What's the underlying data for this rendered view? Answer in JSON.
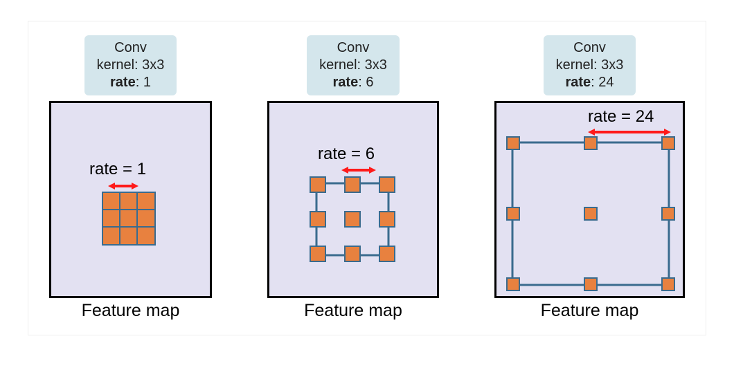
{
  "panels": [
    {
      "conv_title": "Conv",
      "kernel_line": "kernel: 3x3",
      "rate_label_prefix": "rate",
      "rate_value": "1",
      "rate_eq": "rate = 1",
      "fmap_caption": "Feature map"
    },
    {
      "conv_title": "Conv",
      "kernel_line": "kernel: 3x3",
      "rate_label_prefix": "rate",
      "rate_value": "6",
      "rate_eq": "rate = 6",
      "fmap_caption": "Feature map"
    },
    {
      "conv_title": "Conv",
      "kernel_line": "kernel: 3x3",
      "rate_label_prefix": "rate",
      "rate_value": "24",
      "rate_eq": "rate = 24",
      "fmap_caption": "Feature map"
    }
  ],
  "colors": {
    "cell_fill": "#e8813f",
    "cell_stroke": "#3a6b8e",
    "fmap_bg": "#e3e1f2",
    "conv_bg": "#d4e6ec",
    "arrow": "#ff1a1a"
  }
}
